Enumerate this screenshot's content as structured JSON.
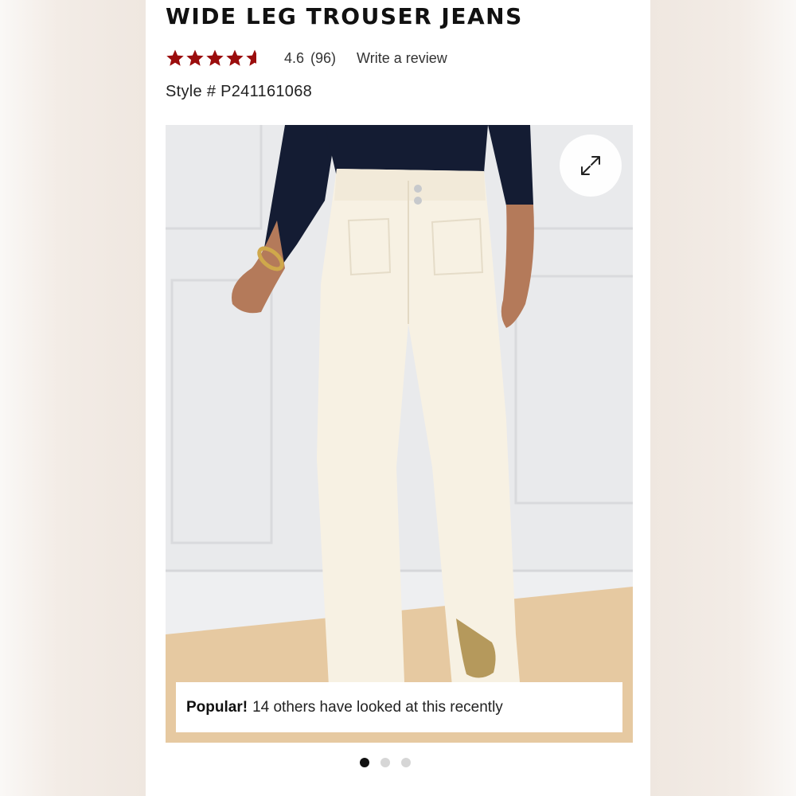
{
  "product": {
    "title": "WIDE LEG TROUSER JEANS",
    "rating": {
      "value": "4.6",
      "count": "(96)",
      "stars_filled": 4.6,
      "stars_total": 5,
      "star_color": "#9b0d0d"
    },
    "write_review_label": "Write a review",
    "style_label": "Style # P241161068"
  },
  "gallery": {
    "expand_icon": "expand-arrows-icon",
    "popular_strong": "Popular!",
    "popular_text": "14 others have looked at this recently",
    "dots_total": 3,
    "active_dot": 1
  },
  "colors": {
    "pants": "#f7f1e3",
    "top": "#141c33",
    "wall": "#e8e9eb",
    "floor": "#e8cda7"
  }
}
